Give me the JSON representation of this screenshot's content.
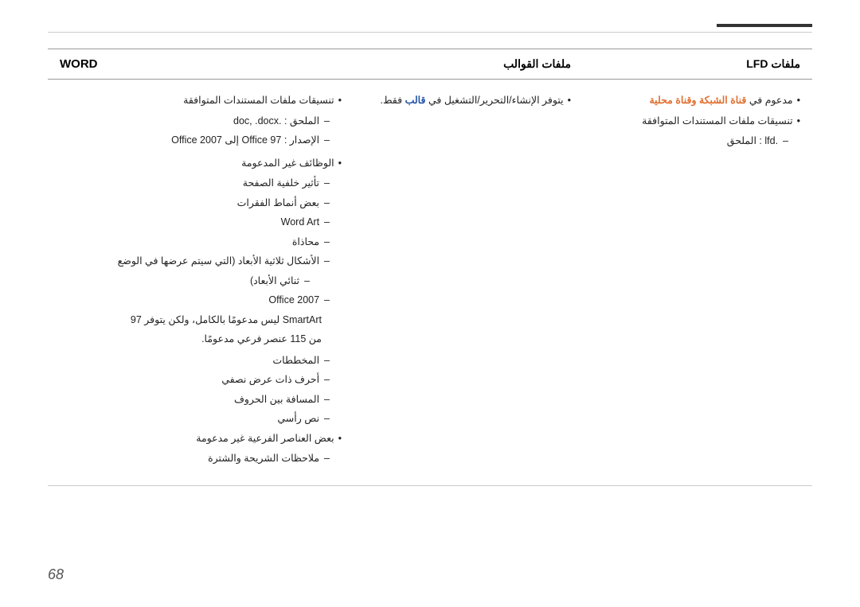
{
  "page": {
    "number": "68",
    "top_bar_right": true
  },
  "table": {
    "headers": {
      "word": "WORD",
      "templates": "ملفات القوالب",
      "lfd": "ملفات LFD"
    },
    "word_column": {
      "section1_label": "تنسيقات ملفات المستندات المتوافقة",
      "sub1_label": "الملحق :",
      "sub1_value": ".doc, .docx",
      "sub2_label": "الإصدار :",
      "sub2_value": "Office 97 إلى Office 2007",
      "section2_label": "الوظائف غير المدعومة",
      "sub_page_bg": "تأثير خلفية الصفحة",
      "sub_para": "بعض أنماط الفقرات",
      "sub_wordart": "Word Art",
      "sub_protection": "محاذاة",
      "sub_3d_label": "الأشكال ثلاثية الأبعاد (التي سيتم عرضها في الوضع",
      "sub_3d_value": "ثنائي الأبعاد)",
      "sub_office_label": "Office 2007",
      "sub_smartart": "SmartArt ليس مدعومًا بالكامل، ولكن يتوفر 97",
      "sub_smartart2": "من 115 عنصر فرعي مدعومًا.",
      "sub_charts": "المخططات",
      "sub_half_chars": "أحرف ذات عرض نصفي",
      "sub_char_spacing": "المسافة بين الحروف",
      "sub_vertical": "نص رأسي",
      "sub_some_features": "بعض العناصر الفرعية غير مدعومة",
      "sub_footnotes": "ملاحظات الشريحة والشترة"
    },
    "templates_column": {
      "bullet1": "يتوفر  الإنشاء/التحرير/التشغيل في",
      "bullet1_colored": "قالب",
      "bullet1_end": "فقط."
    },
    "lfd_column": {
      "bullet1": "مدعوم في",
      "bullet1_colored": "قناة الشبكة وقناة محلية",
      "bullet2": "تنسيقات ملفات المستندات المتوافقة",
      "sub_lfd": ".lfd : الملحق"
    }
  }
}
